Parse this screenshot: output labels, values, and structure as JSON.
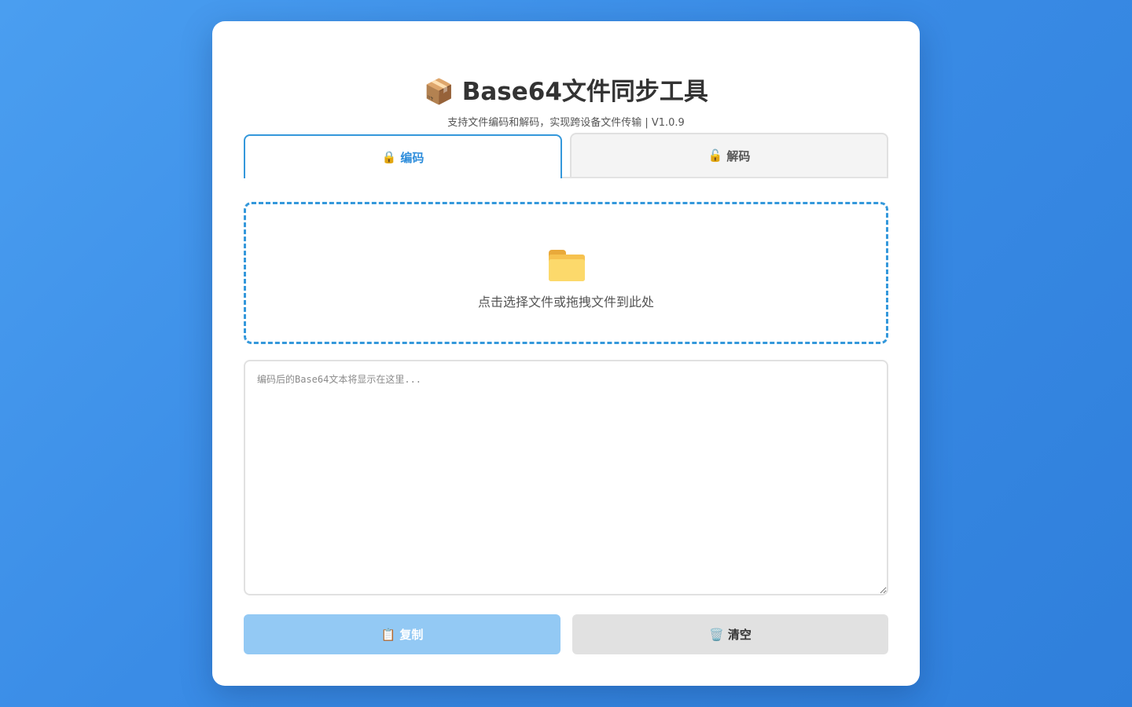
{
  "header": {
    "title_icon": "package-icon",
    "title_emoji": "📦",
    "title": "Base64文件同步工具",
    "subtitle": "支持文件编码和解码，实现跨设备文件传输 | V1.0.9"
  },
  "tabs": [
    {
      "icon": "lock-icon",
      "emoji": "🔒",
      "label": "编码",
      "active": true
    },
    {
      "icon": "unlock-icon",
      "emoji": "🔓",
      "label": "解码",
      "active": false
    }
  ],
  "dropzone": {
    "icon": "folder-icon",
    "text": "点击选择文件或拖拽文件到此处"
  },
  "output": {
    "value": "",
    "placeholder": "编码后的Base64文本将显示在这里..."
  },
  "buttons": {
    "copy": {
      "icon": "clipboard-icon",
      "emoji": "📋",
      "label": "复制"
    },
    "clear": {
      "icon": "trash-icon",
      "emoji": "🗑️",
      "label": "清空"
    }
  },
  "colors": {
    "accent": "#3498db",
    "copy_button": "#93c9f4",
    "clear_button": "#e1e1e1",
    "background_start": "#4a9ef0",
    "background_end": "#2f7fdb"
  }
}
